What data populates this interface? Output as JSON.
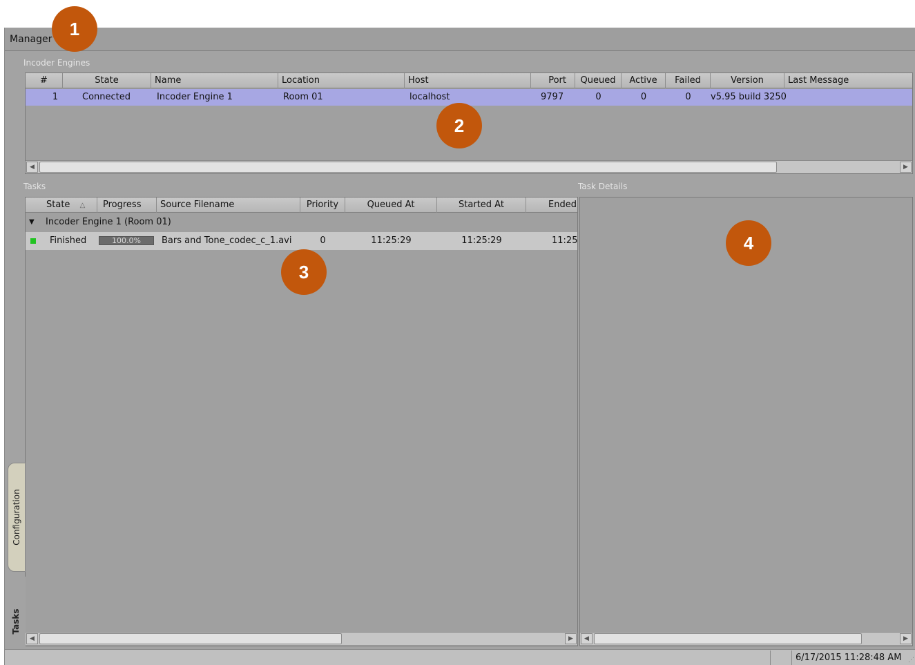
{
  "window": {
    "title": "Manager"
  },
  "engines": {
    "section_label": "Incoder Engines",
    "columns": [
      "#",
      "State",
      "Name",
      "Location",
      "Host",
      "Port",
      "Queued",
      "Active",
      "Failed",
      "Version",
      "Last Message"
    ],
    "rows": [
      {
        "num": "1",
        "state": "Connected",
        "name": "Incoder Engine 1",
        "location": "Room 01",
        "host": "localhost",
        "port": "9797",
        "queued": "0",
        "active": "0",
        "failed": "0",
        "version": "v5.95 build 3250",
        "last_message": ""
      }
    ]
  },
  "tasks": {
    "section_label": "Tasks",
    "columns": [
      "State",
      "Progress",
      "Source Filename",
      "Priority",
      "Queued At",
      "Started At",
      "Ended"
    ],
    "sort_indicator": "△",
    "group_label": "Incoder Engine 1 (Room 01)",
    "rows": [
      {
        "state": "Finished",
        "progress": "100.0%",
        "progress_value": 1.0,
        "filename": "Bars and Tone_codec_c_1.avi",
        "priority": "0",
        "queued_at": "11:25:29",
        "started_at": "11:25:29",
        "ended": "11:25"
      }
    ]
  },
  "task_details": {
    "section_label": "Task Details"
  },
  "side_tabs": [
    "Configuration",
    "Tasks"
  ],
  "status_bar": {
    "datetime": "6/17/2015 11:28:48 AM"
  },
  "callouts": [
    "1",
    "2",
    "3",
    "4"
  ],
  "colors": {
    "accent": "#c2570c",
    "selected_row": "#a7a7e3",
    "status_ok": "#22c322"
  }
}
